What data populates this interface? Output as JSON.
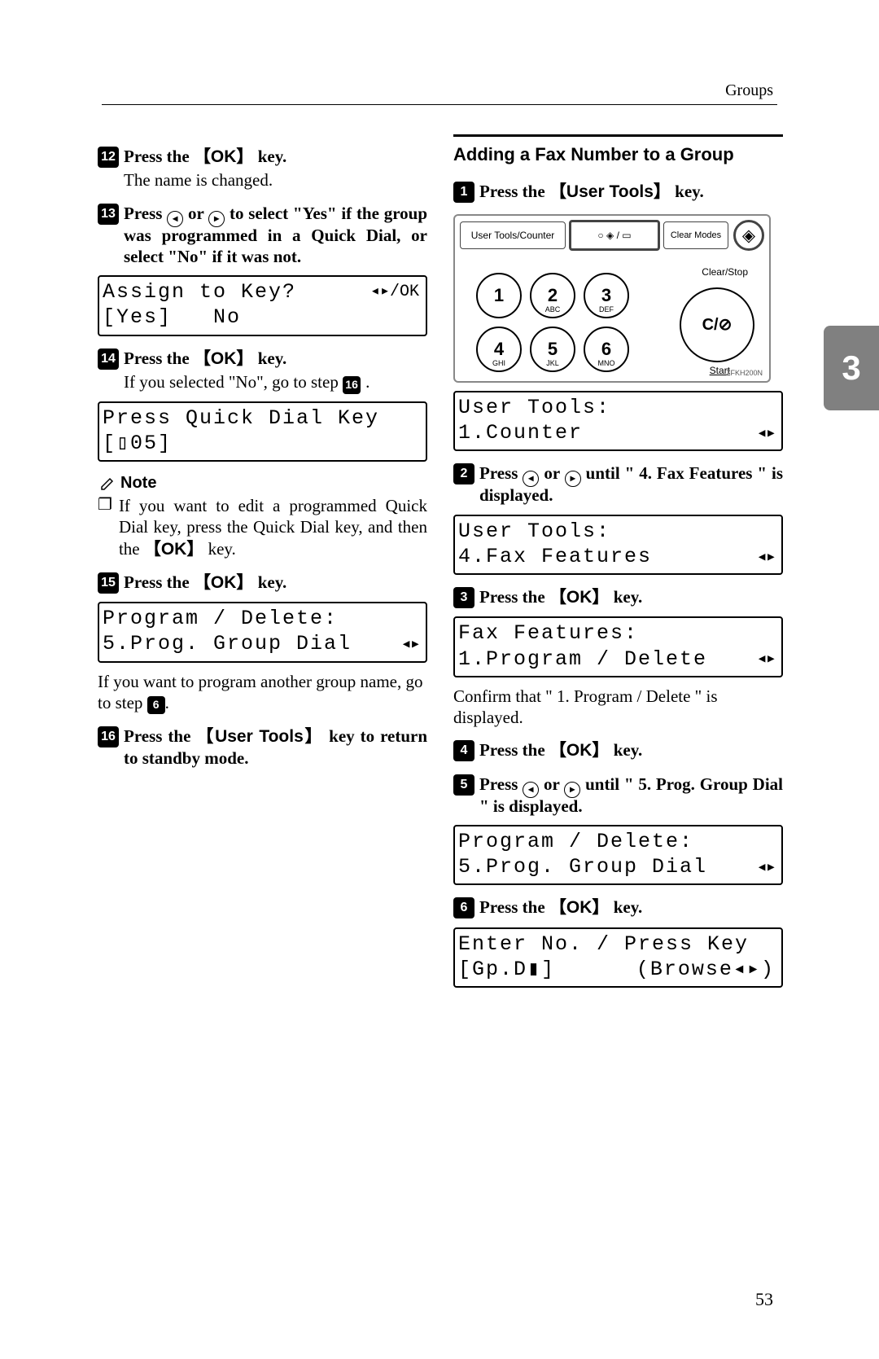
{
  "header": {
    "section": "Groups"
  },
  "page_number": "53",
  "chapter_tab": "3",
  "left": {
    "s12": {
      "num": "12",
      "text": "Press the 【OK】 key.",
      "result": "The name is changed."
    },
    "s13": {
      "num": "13",
      "text_full": "Press ◀ or ▶ to select \"Yes\" if the group was programmed in a Quick Dial, or select \"No\" if it was not.",
      "lcd": {
        "l1a": "Assign to Key?",
        "l1b": "◂▸/OK",
        "l2": "[Yes]   No"
      }
    },
    "s14": {
      "num": "14",
      "text": "Press the 【OK】 key.",
      "result_a": "If you selected \"No\", go to step ",
      "result_badge": "16",
      "result_b": ".",
      "lcd": {
        "l1": "Press Quick Dial Key",
        "l2": "[▯05]"
      }
    },
    "note": {
      "label": "Note",
      "body": "If you want to edit a programmed Quick Dial key, press the Quick Dial key, and then the 【OK】 key."
    },
    "s15": {
      "num": "15",
      "text": "Press the 【OK】 key.",
      "lcd": {
        "l1": "Program / Delete:",
        "l2a": "5.Prog. Group Dial",
        "l2b": "◂▸"
      },
      "after_a": "If you want to program another group name, go to step ",
      "after_badge": "6",
      "after_b": "."
    },
    "s16": {
      "num": "16",
      "text": "Press the 【User Tools】 key to return to standby mode."
    }
  },
  "right": {
    "title": "Adding a Fax Number to a Group",
    "s1": {
      "num": "1",
      "text": "Press the 【User Tools】 key.",
      "panel": {
        "ut": "User Tools/Counter",
        "clearmodes": "Clear Modes",
        "clearstop": "Clear/Stop",
        "cbtn": "C/⊘",
        "start": "Start",
        "code": "ZFKH200N",
        "keys": [
          {
            "n": "1",
            "s": ""
          },
          {
            "n": "2",
            "s": "ABC"
          },
          {
            "n": "3",
            "s": "DEF"
          },
          {
            "n": "4",
            "s": "GHI"
          },
          {
            "n": "5",
            "s": "JKL"
          },
          {
            "n": "6",
            "s": "MNO"
          }
        ]
      },
      "lcd": {
        "l1": "User Tools:",
        "l2a": "1.Counter",
        "l2b": "◂▸"
      }
    },
    "s2": {
      "num": "2",
      "text": "Press ◀ or ▶ until \" 4. Fax Features \" is displayed.",
      "lcd": {
        "l1": "User Tools:",
        "l2a": "4.Fax Features",
        "l2b": "◂▸"
      }
    },
    "s3": {
      "num": "3",
      "text": "Press the 【OK】 key.",
      "lcd": {
        "l1": "Fax Features:",
        "l2a": "1.Program / Delete",
        "l2b": "◂▸"
      },
      "after": "Confirm that \" 1. Program / Delete \" is displayed."
    },
    "s4": {
      "num": "4",
      "text": "Press the 【OK】 key."
    },
    "s5": {
      "num": "5",
      "text": "Press ◀ or ▶ until \" 5. Prog. Group Dial \" is displayed.",
      "lcd": {
        "l1": "Program / Delete:",
        "l2a": "5.Prog. Group Dial",
        "l2b": "◂▸"
      }
    },
    "s6": {
      "num": "6",
      "text": "Press the 【OK】 key.",
      "lcd": {
        "l1": "Enter No. / Press Key",
        "l2a": "[Gp.D▮]",
        "l2b": "(Browse◂▸)"
      }
    }
  }
}
